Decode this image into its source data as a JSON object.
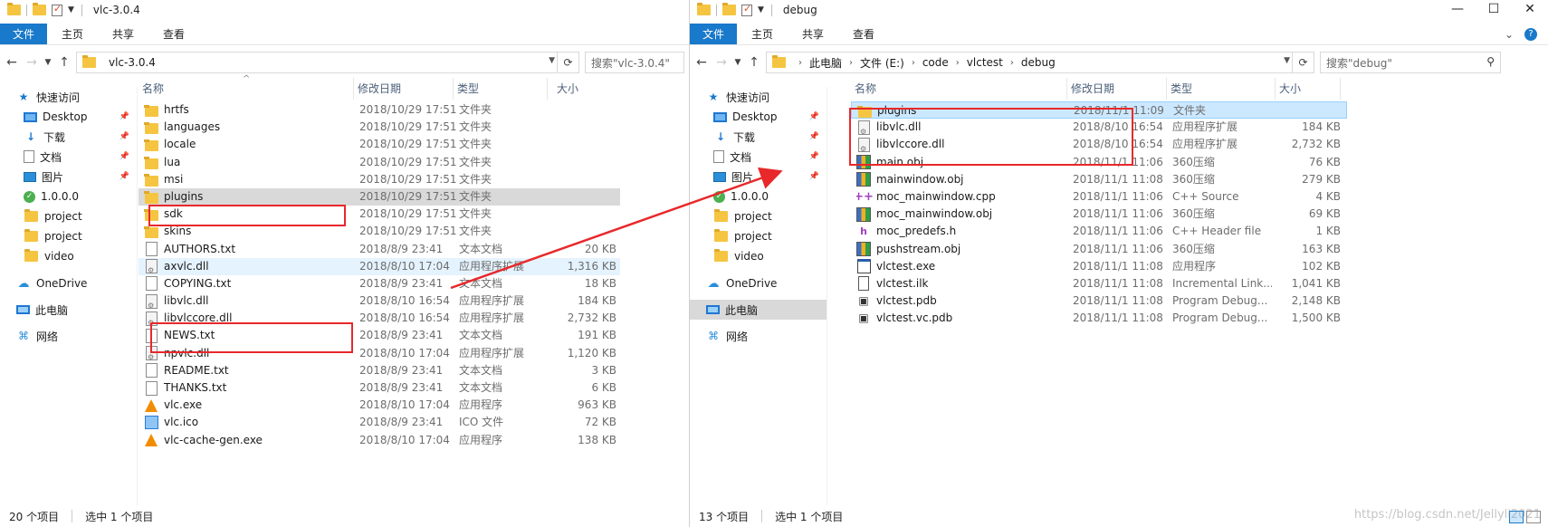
{
  "left": {
    "title": "vlc-3.0.4",
    "ribbon_tabs": [
      "文件",
      "主页",
      "共享",
      "查看"
    ],
    "address": [
      "vlc-3.0.4"
    ],
    "search_placeholder": "搜索\"vlc-3.0.4\"",
    "columns": {
      "name": "名称",
      "date": "修改日期",
      "type": "类型",
      "size": "大小"
    },
    "nav": [
      {
        "label": "快速访问",
        "icon": "star-icon",
        "pin": false
      },
      {
        "label": "Desktop",
        "icon": "desktop-icon",
        "pin": true
      },
      {
        "label": "下载",
        "icon": "download-icon",
        "pin": true
      },
      {
        "label": "文档",
        "icon": "document-icon",
        "pin": true
      },
      {
        "label": "图片",
        "icon": "pictures-icon",
        "pin": true
      },
      {
        "label": "1.0.0.0",
        "icon": "version-icon",
        "pin": false
      },
      {
        "label": "project",
        "icon": "folder-icon",
        "pin": false
      },
      {
        "label": "project",
        "icon": "folder-icon",
        "pin": false
      },
      {
        "label": "video",
        "icon": "folder-icon",
        "pin": false
      },
      {
        "label": "OneDrive",
        "icon": "onedrive-icon",
        "pin": false
      },
      {
        "label": "此电脑",
        "icon": "this-pc-icon",
        "pin": false
      },
      {
        "label": "网络",
        "icon": "network-icon",
        "pin": false
      }
    ],
    "files": [
      {
        "name": "hrtfs",
        "date": "2018/10/29 17:51",
        "type": "文件夹",
        "size": "",
        "icon": "folder"
      },
      {
        "name": "languages",
        "date": "2018/10/29 17:51",
        "type": "文件夹",
        "size": "",
        "icon": "folder"
      },
      {
        "name": "locale",
        "date": "2018/10/29 17:51",
        "type": "文件夹",
        "size": "",
        "icon": "folder"
      },
      {
        "name": "lua",
        "date": "2018/10/29 17:51",
        "type": "文件夹",
        "size": "",
        "icon": "folder"
      },
      {
        "name": "msi",
        "date": "2018/10/29 17:51",
        "type": "文件夹",
        "size": "",
        "icon": "folder"
      },
      {
        "name": "plugins",
        "date": "2018/10/29 17:51",
        "type": "文件夹",
        "size": "",
        "icon": "folder",
        "state": "grey"
      },
      {
        "name": "sdk",
        "date": "2018/10/29 17:51",
        "type": "文件夹",
        "size": "",
        "icon": "folder"
      },
      {
        "name": "skins",
        "date": "2018/10/29 17:51",
        "type": "文件夹",
        "size": "",
        "icon": "folder"
      },
      {
        "name": "AUTHORS.txt",
        "date": "2018/8/9 23:41",
        "type": "文本文档",
        "size": "20 KB",
        "icon": "txt"
      },
      {
        "name": "axvlc.dll",
        "date": "2018/8/10 17:04",
        "type": "应用程序扩展",
        "size": "1,316 KB",
        "icon": "dll",
        "state": "hover"
      },
      {
        "name": "COPYING.txt",
        "date": "2018/8/9 23:41",
        "type": "文本文档",
        "size": "18 KB",
        "icon": "txt"
      },
      {
        "name": "libvlc.dll",
        "date": "2018/8/10 16:54",
        "type": "应用程序扩展",
        "size": "184 KB",
        "icon": "dll"
      },
      {
        "name": "libvlccore.dll",
        "date": "2018/8/10 16:54",
        "type": "应用程序扩展",
        "size": "2,732 KB",
        "icon": "dll"
      },
      {
        "name": "NEWS.txt",
        "date": "2018/8/9 23:41",
        "type": "文本文档",
        "size": "191 KB",
        "icon": "txt"
      },
      {
        "name": "npvlc.dll",
        "date": "2018/8/10 17:04",
        "type": "应用程序扩展",
        "size": "1,120 KB",
        "icon": "dll"
      },
      {
        "name": "README.txt",
        "date": "2018/8/9 23:41",
        "type": "文本文档",
        "size": "3 KB",
        "icon": "txt"
      },
      {
        "name": "THANKS.txt",
        "date": "2018/8/9 23:41",
        "type": "文本文档",
        "size": "6 KB",
        "icon": "txt"
      },
      {
        "name": "vlc.exe",
        "date": "2018/8/10 17:04",
        "type": "应用程序",
        "size": "963 KB",
        "icon": "vlc"
      },
      {
        "name": "vlc.ico",
        "date": "2018/8/9 23:41",
        "type": "ICO 文件",
        "size": "72 KB",
        "icon": "ico"
      },
      {
        "name": "vlc-cache-gen.exe",
        "date": "2018/8/10 17:04",
        "type": "应用程序",
        "size": "138 KB",
        "icon": "vlc"
      }
    ],
    "status_count": "20 个项目",
    "status_selected": "选中 1 个项目"
  },
  "right": {
    "title": "debug",
    "ribbon_tabs": [
      "文件",
      "主页",
      "共享",
      "查看"
    ],
    "address": [
      "此电脑",
      "文件 (E:)",
      "code",
      "vlctest",
      "debug"
    ],
    "search_placeholder": "搜索\"debug\"",
    "columns": {
      "name": "名称",
      "date": "修改日期",
      "type": "类型",
      "size": "大小"
    },
    "nav": [
      {
        "label": "快速访问",
        "icon": "star-icon",
        "pin": false
      },
      {
        "label": "Desktop",
        "icon": "desktop-icon",
        "pin": true
      },
      {
        "label": "下载",
        "icon": "download-icon",
        "pin": true
      },
      {
        "label": "文档",
        "icon": "document-icon",
        "pin": true
      },
      {
        "label": "图片",
        "icon": "pictures-icon",
        "pin": true
      },
      {
        "label": "1.0.0.0",
        "icon": "version-icon",
        "pin": false
      },
      {
        "label": "project",
        "icon": "folder-icon",
        "pin": false
      },
      {
        "label": "project",
        "icon": "folder-icon",
        "pin": false
      },
      {
        "label": "video",
        "icon": "folder-icon",
        "pin": false
      },
      {
        "label": "OneDrive",
        "icon": "onedrive-icon",
        "pin": false
      },
      {
        "label": "此电脑",
        "icon": "this-pc-icon",
        "pin": false,
        "selected": true
      },
      {
        "label": "网络",
        "icon": "network-icon",
        "pin": false
      }
    ],
    "files": [
      {
        "name": "plugins",
        "date": "2018/11/1 11:09",
        "type": "文件夹",
        "size": "",
        "icon": "folder",
        "state": "sel"
      },
      {
        "name": "libvlc.dll",
        "date": "2018/8/10 16:54",
        "type": "应用程序扩展",
        "size": "184 KB",
        "icon": "dll"
      },
      {
        "name": "libvlccore.dll",
        "date": "2018/8/10 16:54",
        "type": "应用程序扩展",
        "size": "2,732 KB",
        "icon": "dll"
      },
      {
        "name": "main.obj",
        "date": "2018/11/1 11:06",
        "type": "360压缩",
        "size": "76 KB",
        "icon": "obj"
      },
      {
        "name": "mainwindow.obj",
        "date": "2018/11/1 11:08",
        "type": "360压缩",
        "size": "279 KB",
        "icon": "obj"
      },
      {
        "name": "moc_mainwindow.cpp",
        "date": "2018/11/1 11:06",
        "type": "C++ Source",
        "size": "4 KB",
        "icon": "cpp"
      },
      {
        "name": "moc_mainwindow.obj",
        "date": "2018/11/1 11:06",
        "type": "360压缩",
        "size": "69 KB",
        "icon": "obj"
      },
      {
        "name": "moc_predefs.h",
        "date": "2018/11/1 11:06",
        "type": "C++ Header file",
        "size": "1 KB",
        "icon": "h"
      },
      {
        "name": "pushstream.obj",
        "date": "2018/11/1 11:06",
        "type": "360压缩",
        "size": "163 KB",
        "icon": "obj"
      },
      {
        "name": "vlctest.exe",
        "date": "2018/11/1 11:08",
        "type": "应用程序",
        "size": "102 KB",
        "icon": "exe"
      },
      {
        "name": "vlctest.ilk",
        "date": "2018/11/1 11:08",
        "type": "Incremental Link...",
        "size": "1,041 KB",
        "icon": "ilk"
      },
      {
        "name": "vlctest.pdb",
        "date": "2018/11/1 11:08",
        "type": "Program Debug...",
        "size": "2,148 KB",
        "icon": "pdb"
      },
      {
        "name": "vlctest.vc.pdb",
        "date": "2018/11/1 11:08",
        "type": "Program Debug...",
        "size": "1,500 KB",
        "icon": "pdb"
      }
    ],
    "status_count": "13 个项目",
    "status_selected": "选中 1 个项目"
  },
  "watermark": "https://blog.csdn.net/Jellyli2021",
  "colors": {
    "accent": "#1979ca",
    "annotation": "#e8282a",
    "selection": "#cce8ff"
  }
}
